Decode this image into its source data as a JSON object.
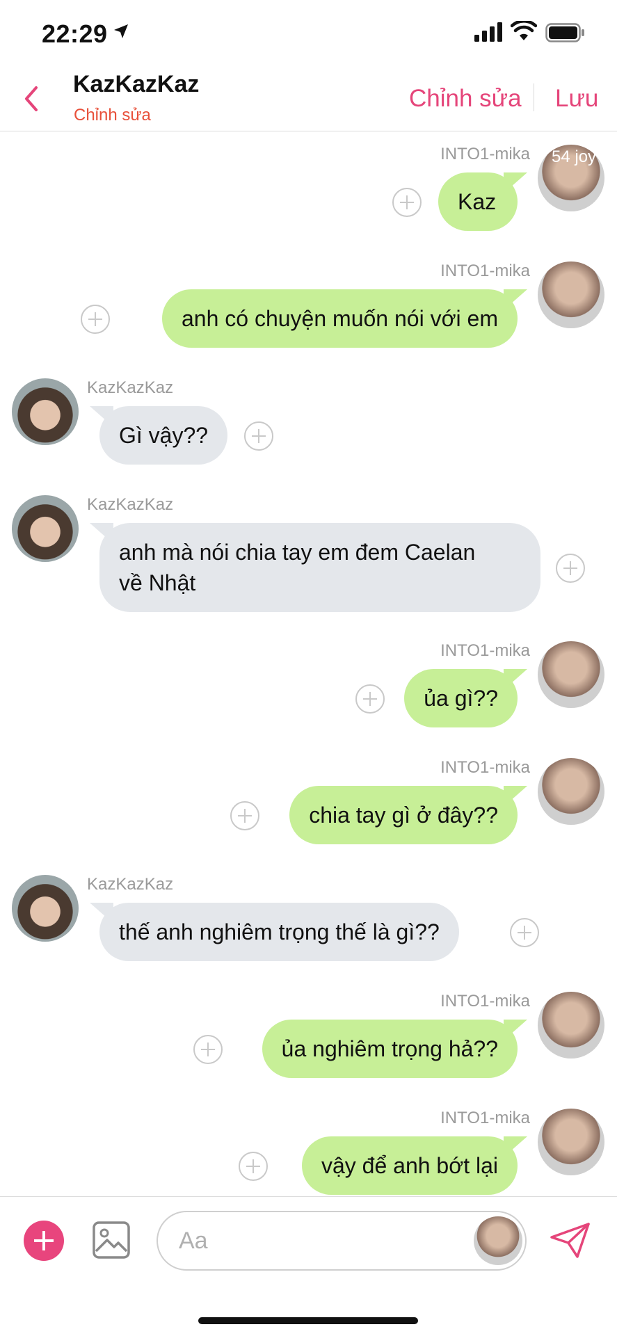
{
  "status_bar": {
    "time": "22:29"
  },
  "header": {
    "title": "KazKazKaz",
    "subtitle": "Chỉnh sửa",
    "edit_label": "Chỉnh sửa",
    "save_label": "Lưu"
  },
  "timer_badge": "54 joy",
  "messages": [
    {
      "side": "right",
      "sender": "INTO1-mika",
      "text": "Kaz"
    },
    {
      "side": "right",
      "sender": "INTO1-mika",
      "text": "anh có chuyện muốn nói với em"
    },
    {
      "side": "left",
      "sender": "KazKazKaz",
      "text": "Gì vậy??"
    },
    {
      "side": "left",
      "sender": "KazKazKaz",
      "text": "anh mà nói chia tay em đem Caelan\nvề Nhật"
    },
    {
      "side": "right",
      "sender": "INTO1-mika",
      "text": "ủa gì??"
    },
    {
      "side": "right",
      "sender": "INTO1-mika",
      "text": "chia tay gì ở đây??"
    },
    {
      "side": "left",
      "sender": "KazKazKaz",
      "text": "thế anh nghiêm trọng thế là gì??"
    },
    {
      "side": "right",
      "sender": "INTO1-mika",
      "text": "ủa nghiêm trọng hả??"
    },
    {
      "side": "right",
      "sender": "INTO1-mika",
      "text": "vậy để anh bớt lại"
    }
  ],
  "composer": {
    "placeholder": "Aa"
  },
  "colors": {
    "accent": "#e5457a",
    "right_bubble": "#c7ef97",
    "left_bubble": "#e4e7eb",
    "subtitle": "#e8503a"
  },
  "icons": [
    "location-arrow-icon",
    "signal-icon",
    "wifi-icon",
    "battery-icon",
    "back-chevron-icon",
    "plus-circle-icon",
    "image-icon",
    "send-icon"
  ]
}
